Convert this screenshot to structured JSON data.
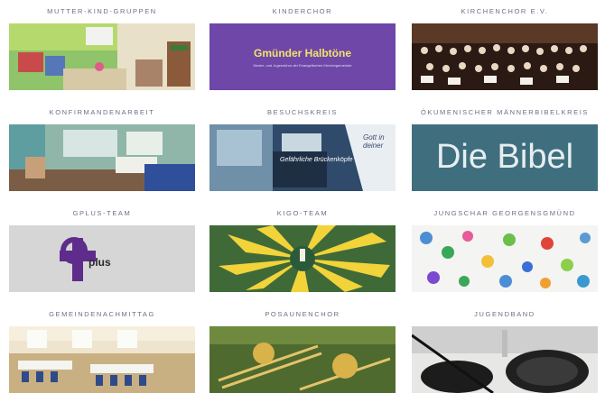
{
  "groups": [
    {
      "title": "MUTTER-KIND-GRUPPEN",
      "image": "playroom-photo"
    },
    {
      "title": "KINDERCHOR",
      "image": "kinderchor-logo",
      "logo_text": "Gmünder Halbtöne",
      "logo_subtitle": "Kinder- und Jugendchor der Evangelischen Kirchengemeinde"
    },
    {
      "title": "KIRCHENCHOR E.V.",
      "image": "choir-photo"
    },
    {
      "title": "KONFIRMANDENARBEIT",
      "image": "youth-room-photo"
    },
    {
      "title": "BESUCHSKREIS",
      "image": "church-interior-photo",
      "card_text": "Gefährliche Brückenköpfe",
      "card_text_2": "Gott in deiner"
    },
    {
      "title": "ÖKUMENISCHER MÄNNERBIBELKREIS",
      "image": "bible-banner",
      "banner_text": "Die Bibel"
    },
    {
      "title": "GPLUS-TEAM",
      "image": "gplus-logo",
      "logo_text": "plus"
    },
    {
      "title": "KIGO-TEAM",
      "image": "kigo-sun-photo"
    },
    {
      "title": "JUNGSCHAR GEORGENSGMÜND",
      "image": "handprints-photo"
    },
    {
      "title": "GEMEINDENACHMITTAG",
      "image": "hall-photo"
    },
    {
      "title": "POSAUNENCHOR",
      "image": "trombones-photo"
    },
    {
      "title": "JUGENDBAND",
      "image": "drums-photo"
    }
  ],
  "colors": {
    "title": "#6b6f86",
    "kinderchor_purple": "#6e47a8",
    "bible_teal": "#3f6f7e"
  }
}
